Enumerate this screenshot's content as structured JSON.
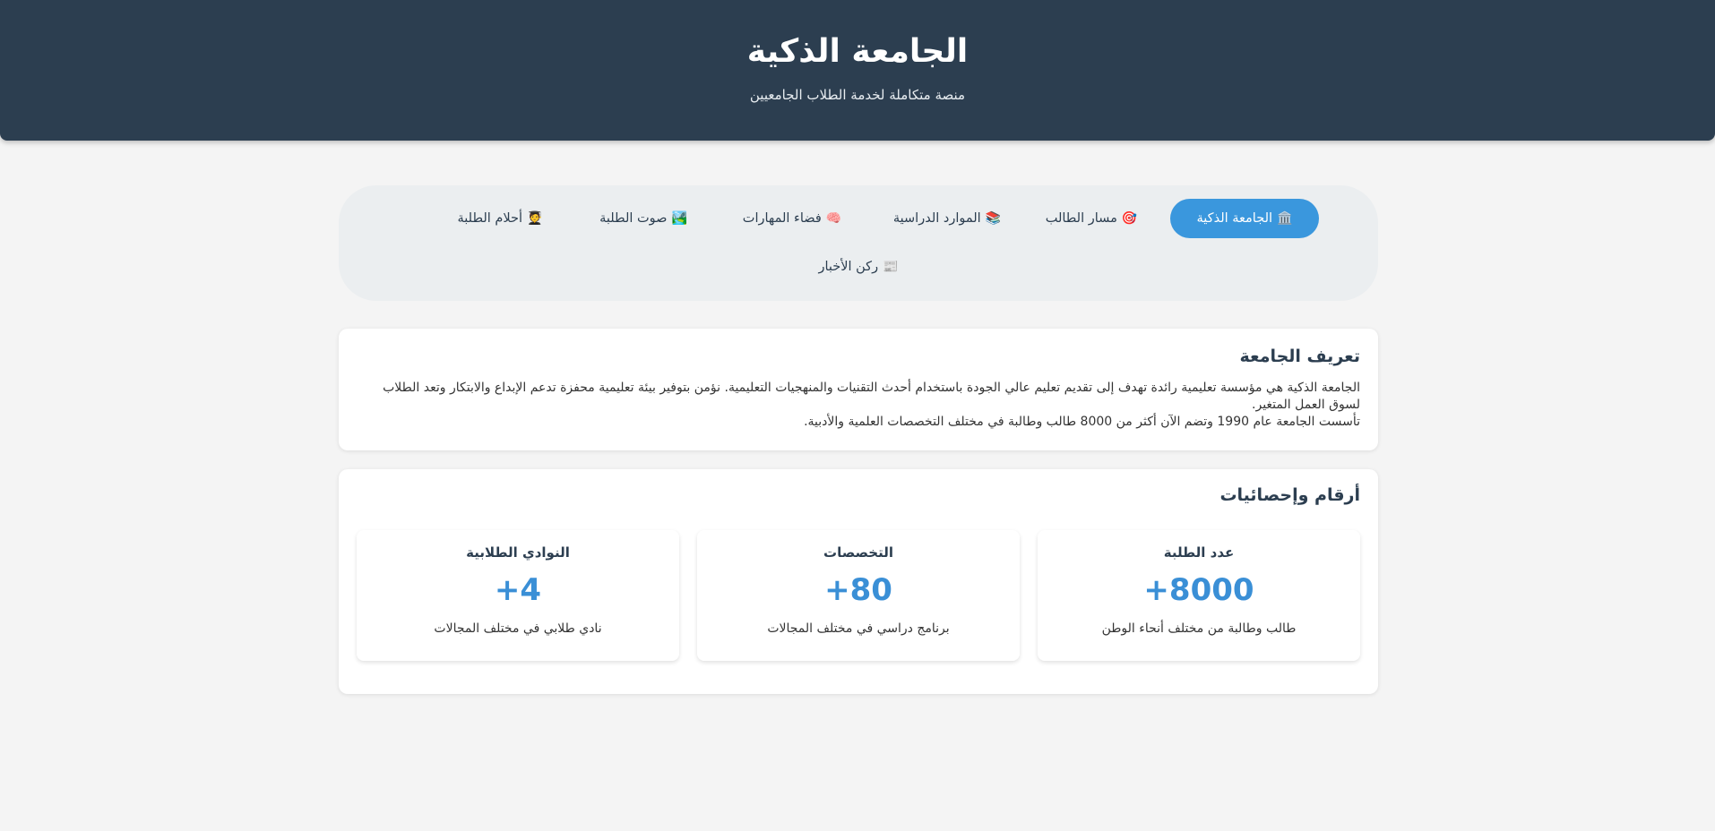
{
  "header": {
    "title": "الجامعة الذكية",
    "subtitle": "منصة متكاملة لخدمة الطلاب الجامعيين"
  },
  "nav": {
    "items": [
      {
        "icon": "🏛️",
        "icon_name": "university-building-icon",
        "label": "الجامعة الذكية",
        "active": true
      },
      {
        "icon": "🎯",
        "icon_name": "target-icon",
        "label": "مسار الطالب",
        "active": false
      },
      {
        "icon": "📚",
        "icon_name": "books-icon",
        "label": "الموارد الدراسية",
        "active": false
      },
      {
        "icon": "🧠",
        "icon_name": "brain-icon",
        "label": "فضاء المهارات",
        "active": false
      },
      {
        "icon": "🏞️",
        "icon_name": "landscape-icon",
        "label": "صوت الطلبة",
        "active": false
      },
      {
        "icon": "🧑‍🎓",
        "icon_name": "student-icon",
        "label": "أحلام الطلبة",
        "active": false
      },
      {
        "icon": "📰",
        "icon_name": "newspaper-icon",
        "label": "ركن الأخبار",
        "active": false
      }
    ]
  },
  "about": {
    "title": "تعريف الجامعة",
    "line1": "الجامعة الذكية هي مؤسسة تعليمية رائدة تهدف إلى تقديم تعليم عالي الجودة باستخدام أحدث التقنيات والمنهجيات التعليمية. نؤمن بتوفير بيئة تعليمية محفزة تدعم الإبداع والابتكار وتعد الطلاب لسوق العمل المتغير.",
    "line2": "تأسست الجامعة عام 1990 وتضم الآن أكثر من 8000 طالب وطالبة في مختلف التخصصات العلمية والأدبية."
  },
  "stats": {
    "title": "أرقام وإحصائيات",
    "items": [
      {
        "title": "عدد الطلبة",
        "value": "8000+",
        "desc": "طالب وطالبة من مختلف أنحاء الوطن"
      },
      {
        "title": "التخصصات",
        "value": "80+",
        "desc": "برنامج دراسي في مختلف المجالات"
      },
      {
        "title": "النوادي الطلابية",
        "value": "4+",
        "desc": "نادي طلابي في مختلف المجالات"
      }
    ]
  },
  "colors": {
    "header_bg": "#2c3e50",
    "accent": "#3a97dd",
    "nav_bg": "#ebeef0",
    "page_bg": "#f4f4f4"
  }
}
